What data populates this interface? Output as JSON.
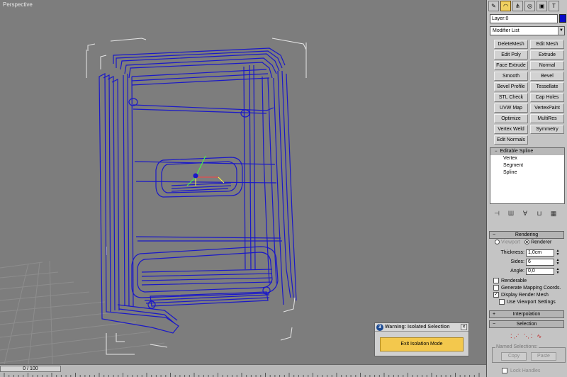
{
  "viewport": {
    "label": "Perspective"
  },
  "command_panel": {
    "tabs": [
      "create-icon",
      "modify-icon",
      "hierarchy-icon",
      "motion-icon",
      "display-icon",
      "utilities-icon"
    ],
    "layer_name": "Layer:0",
    "layer_color": "#0a0ac8",
    "modifier_list": "Modifier List",
    "modifier_buttons": [
      "DeleteMesh",
      "Edit Mesh",
      "Edit Poly",
      "Extrude",
      "Face Extrude",
      "Normal",
      "Smooth",
      "Bevel",
      "Bevel Profile",
      "Tessellate",
      "STL Check",
      "Cap Holes",
      "UVW Map",
      "VertexPaint",
      "Optimize",
      "MultiRes",
      "Vertex Weld",
      "Symmetry",
      "Edit Normals"
    ],
    "stack": {
      "root": "Editable Spline",
      "subobjects": [
        "Vertex",
        "Segment",
        "Spline"
      ]
    }
  },
  "rendering": {
    "title": "Rendering",
    "viewport_label": "Viewport",
    "renderer_label": "Renderer",
    "thickness_label": "Thickness:",
    "thickness_value": "1,0cm",
    "sides_label": "Sides:",
    "sides_value": "6",
    "angle_label": "Angle:",
    "angle_value": "0,0",
    "renderable_label": "Renderable",
    "mapping_label": "Generate Mapping Coords.",
    "display_render_mesh_label": "Display Render Mesh",
    "display_render_mesh_checked": "✓",
    "viewport_settings_label": "Use Viewport Settings"
  },
  "interpolation": {
    "title": "Interpolation",
    "sign": "+"
  },
  "selection": {
    "title": "Selection",
    "sign": "−",
    "named_selections_label": "Named Selections:",
    "copy_label": "Copy",
    "paste_label": "Paste",
    "lock_handles_label": "Lock Handles"
  },
  "warning_dialog": {
    "title": "Warning: Isolated Selection",
    "icon_letter": "3",
    "close_glyph": "×",
    "button_label": "Exit Isolation Mode"
  },
  "timeline": {
    "slider_label": "0 / 100"
  },
  "colors": {
    "viewport_bg": "#7d7d7d",
    "wire": "#1a18c8",
    "bounding_box": "#e6e6e6",
    "warning_button": "#f3c84d"
  }
}
